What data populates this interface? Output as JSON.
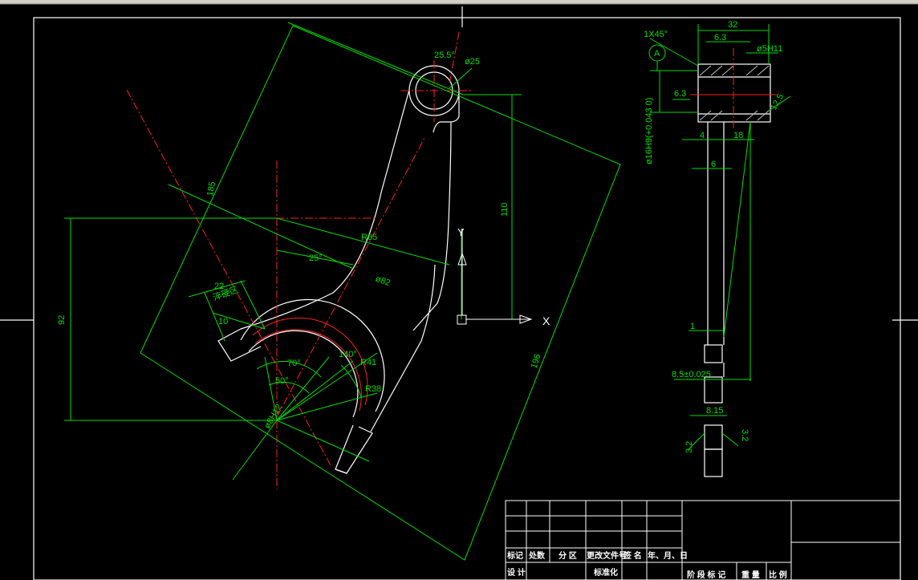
{
  "colors": {
    "background": "#000000",
    "outline": "#ffffff",
    "dimension": "#00e000",
    "centerline": "#ff2020"
  },
  "front_view": {
    "angle_top": "25.5°",
    "hole_dia": "ø25",
    "len_110": "110",
    "len_185": "185",
    "r85": "R85",
    "angle_25": "25°",
    "dia_82": "ø82",
    "w22": "22",
    "hatch_note": "淬硬区",
    "w10": "10",
    "len_92": "92",
    "angle_70": "70°",
    "angle_50": "50°",
    "angle_140": "140°",
    "r41": "R41",
    "r38": "R38",
    "center_dia": "ø8H12",
    "len_196": "196",
    "axis_y": "Y",
    "axis_x": "X"
  },
  "side_view": {
    "w32": "32",
    "chamfer": "1X45°",
    "datum": "A",
    "rough_top": "6.3",
    "hole_top": "ø5H11",
    "rough_left": "6.3",
    "rough_right": "12.5",
    "bore": "ø16H9(+0.043 0)",
    "d4": "4",
    "d18": "18",
    "d6": "6",
    "d1": "1",
    "d85": "8.5±0.025",
    "slot": "8.15",
    "rough_bl": "3.2",
    "rough_br": "3.2"
  },
  "title_block": {
    "row_headers": [
      "标记",
      "处数",
      "分 区",
      "更改文件号",
      "签 名",
      "年、月、日"
    ],
    "bottom_left": [
      "设 计",
      "",
      "标准化"
    ],
    "bottom_right": [
      "阶 段 标 记",
      "重 量",
      "比 例"
    ]
  }
}
